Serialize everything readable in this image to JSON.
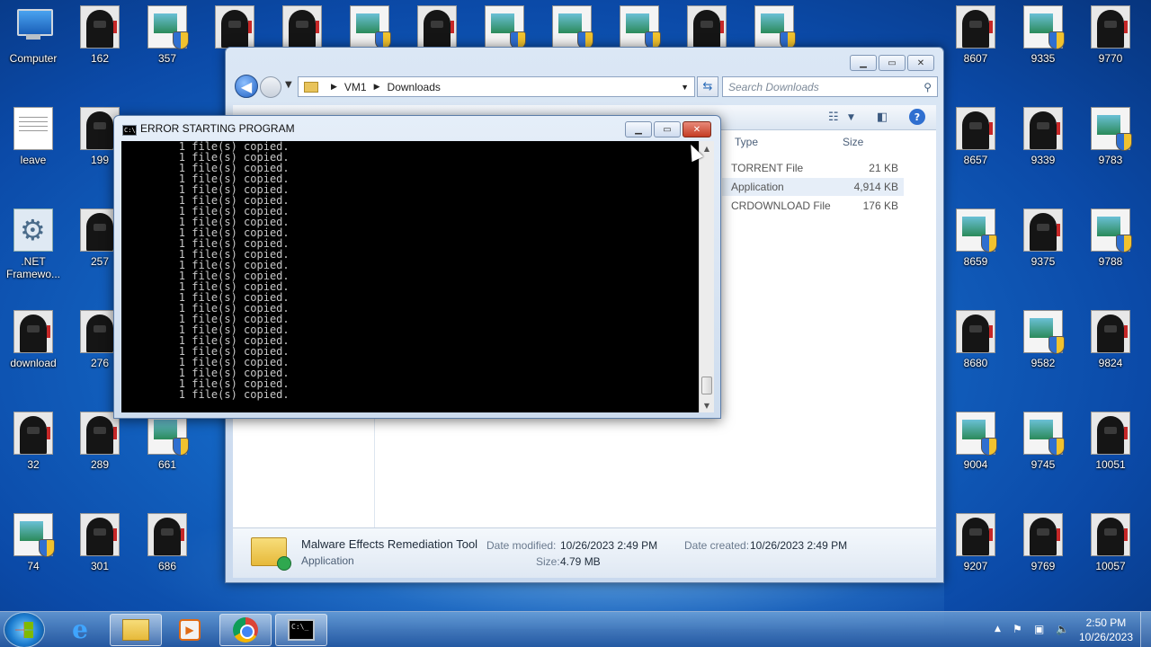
{
  "desktop": {
    "icons": [
      {
        "label": "Computer",
        "type": "pc"
      },
      {
        "label": "162",
        "type": "hood"
      },
      {
        "label": "357",
        "type": "inst"
      },
      {
        "label": "8607",
        "type": "hood"
      },
      {
        "label": "9335",
        "type": "inst"
      },
      {
        "label": "9770",
        "type": "hood"
      },
      {
        "label": "leave",
        "type": "doc"
      },
      {
        "label": "199",
        "type": "hood"
      },
      {
        "label": "8657",
        "type": "hood"
      },
      {
        "label": "9339",
        "type": "hood"
      },
      {
        "label": "9783",
        "type": "inst"
      },
      {
        "label": ".NET Framewo...",
        "type": "gear"
      },
      {
        "label": "257",
        "type": "hood"
      },
      {
        "label": "8659",
        "type": "inst"
      },
      {
        "label": "9375",
        "type": "hood"
      },
      {
        "label": "9788",
        "type": "inst"
      },
      {
        "label": "download",
        "type": "hood"
      },
      {
        "label": "276",
        "type": "hood"
      },
      {
        "label": "8680",
        "type": "hood"
      },
      {
        "label": "9582",
        "type": "inst"
      },
      {
        "label": "9824",
        "type": "hood"
      },
      {
        "label": "32",
        "type": "hood"
      },
      {
        "label": "289",
        "type": "hood"
      },
      {
        "label": "661",
        "type": "inst"
      },
      {
        "label": "9004",
        "type": "inst"
      },
      {
        "label": "9745",
        "type": "inst"
      },
      {
        "label": "10051",
        "type": "hood"
      },
      {
        "label": "74",
        "type": "inst"
      },
      {
        "label": "301",
        "type": "hood"
      },
      {
        "label": "686",
        "type": "hood"
      },
      {
        "label": "9207",
        "type": "hood"
      },
      {
        "label": "9769",
        "type": "hood"
      },
      {
        "label": "10057",
        "type": "hood"
      }
    ],
    "top_strip_icons": [
      "hood",
      "hood",
      "inst",
      "hood",
      "inst",
      "inst",
      "inst",
      "hood",
      "inst"
    ]
  },
  "explorer": {
    "path": [
      "VM1",
      "Downloads"
    ],
    "search_placeholder": "Search Downloads",
    "columns": {
      "type": "Type",
      "size": "Size"
    },
    "files": [
      {
        "type": "TORRENT File",
        "size": "21 KB",
        "selected": false
      },
      {
        "type": "Application",
        "size": "4,914 KB",
        "selected": true
      },
      {
        "type": "CRDOWNLOAD File",
        "size": "176 KB",
        "selected": false
      }
    ],
    "details": {
      "name": "Malware Effects Remediation Tool",
      "kind": "Application",
      "date_modified_label": "Date modified:",
      "date_modified": "10/26/2023 2:49 PM",
      "date_created_label": "Date created:",
      "date_created": "10/26/2023 2:49 PM",
      "size_label": "Size:",
      "size": "4.79 MB"
    }
  },
  "console": {
    "title": "ERROR STARTING PROGRAM",
    "icon_text": "C:\\.",
    "lines": [
      "        1 file(s) copied.",
      "        1 file(s) copied.",
      "        1 file(s) copied.",
      "        1 file(s) copied.",
      "        1 file(s) copied.",
      "        1 file(s) copied.",
      "        1 file(s) copied.",
      "        1 file(s) copied.",
      "        1 file(s) copied.",
      "        1 file(s) copied.",
      "        1 file(s) copied.",
      "        1 file(s) copied.",
      "        1 file(s) copied.",
      "        1 file(s) copied.",
      "        1 file(s) copied.",
      "        1 file(s) copied.",
      "        1 file(s) copied.",
      "        1 file(s) copied.",
      "        1 file(s) copied.",
      "        1 file(s) copied.",
      "        1 file(s) copied.",
      "        1 file(s) copied.",
      "        1 file(s) copied.",
      "        1 file(s) copied."
    ]
  },
  "taskbar": {
    "cmd_icon_text": "C:\\_",
    "time": "2:50 PM",
    "date": "10/26/2023"
  }
}
